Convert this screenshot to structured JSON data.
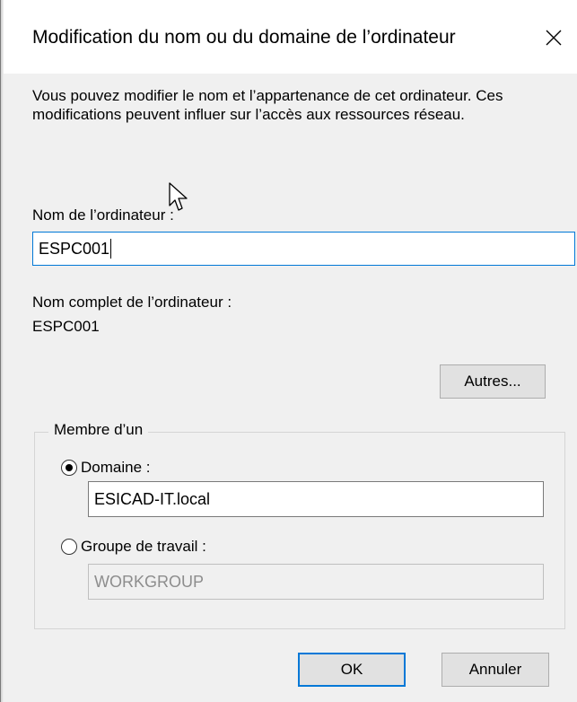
{
  "dialog": {
    "title": "Modification du nom ou du domaine de l’ordinateur",
    "close_icon": "close-icon",
    "description": "Vous pouvez modifier le nom et l’appartenance de cet ordinateur. Ces modifications peuvent influer sur l’accès aux ressources réseau.",
    "computer_name_label": "Nom de l’ordinateur :",
    "computer_name_value": "ESPC001",
    "full_name_label": "Nom complet de l’ordinateur :",
    "full_name_value": "ESPC001",
    "more_button": "Autres...",
    "member_of": {
      "legend": "Membre d’un",
      "domain_label": "Domaine :",
      "domain_selected": true,
      "domain_value": "ESICAD-IT.local",
      "workgroup_label": "Groupe de travail :",
      "workgroup_selected": false,
      "workgroup_value": "WORKGROUP"
    },
    "ok_button": "OK",
    "cancel_button": "Annuler"
  },
  "colors": {
    "focus_accent": "#0078d7",
    "dialog_background": "#f0f0f0",
    "disabled_text": "#8d8d8d"
  }
}
